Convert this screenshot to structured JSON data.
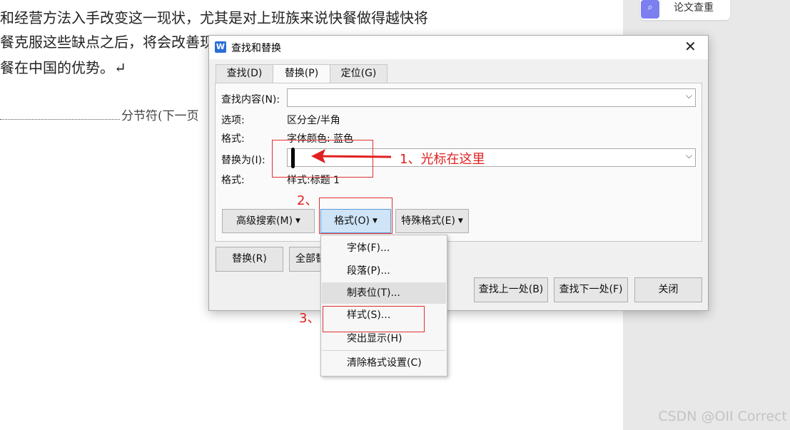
{
  "document": {
    "lines": [
      "和经营方法入手改变这一现状，尤其是对上班族来说快餐做得越快将",
      "餐克服这些缺点之后，将会改善现有的状况，使得中式快餐业的市场",
      "餐在中国的优势。↵"
    ],
    "section_break": "分节符(下一页"
  },
  "right_panel": {
    "plagiarism_button": "论文查重",
    "watermark": "CSDN @OII Correct"
  },
  "dialog": {
    "title": "查找和替换",
    "app_icon": "W",
    "close_icon": "✕",
    "tabs": [
      "查找(D)",
      "替换(P)",
      "定位(G)"
    ],
    "active_tab": "替换(P)",
    "find_label": "查找内容(N):",
    "find_value": "",
    "options_label": "选项:",
    "options_value": "区分全/半角",
    "find_format_label": "格式:",
    "find_format_value": "字体颜色: 蓝色",
    "replace_label": "替换为(I):",
    "replace_value": "",
    "replace_format_label": "格式:",
    "replace_format_value": "样式:标题 1",
    "advanced_search": "高级搜索(M)",
    "format_button": "格式(O)",
    "special_format": "特殊格式(E)",
    "replace_button": "替换(R)",
    "replace_all_button": "全部替",
    "find_prev": "查找上一处(B)",
    "find_next": "查找下一处(F)",
    "close_button": "关闭",
    "dropdown_glyph": "▼",
    "combo_glyph": "⌵"
  },
  "format_menu": {
    "items": [
      "字体(F)...",
      "段落(P)...",
      "制表位(T)...",
      "样式(S)...",
      "突出显示(H)",
      "清除格式设置(C)"
    ],
    "hovered": "制表位(T)..."
  },
  "annotations": {
    "step1": "1、光标在这里",
    "step2": "2、",
    "step3": "3、",
    "color": "#e02020"
  }
}
